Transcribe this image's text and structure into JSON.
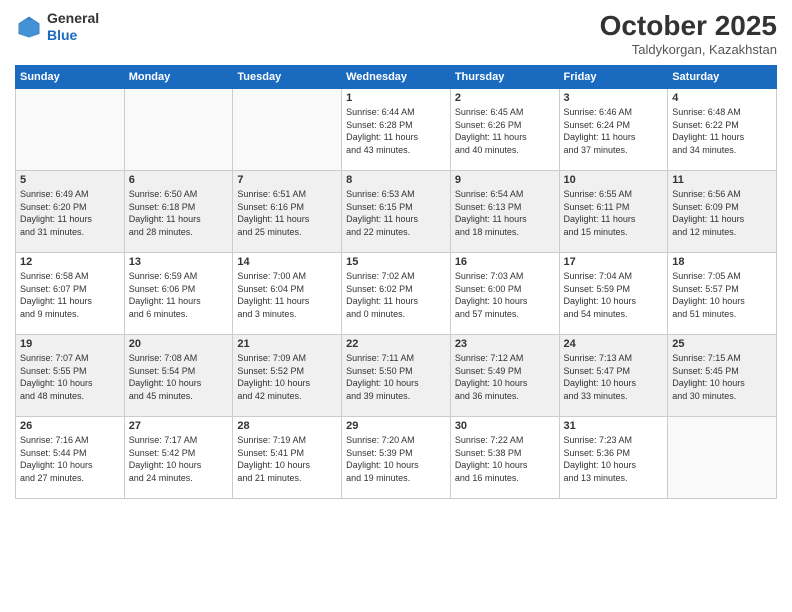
{
  "header": {
    "logo_line1": "General",
    "logo_line2": "Blue",
    "month": "October 2025",
    "location": "Taldykorgan, Kazakhstan"
  },
  "days_of_week": [
    "Sunday",
    "Monday",
    "Tuesday",
    "Wednesday",
    "Thursday",
    "Friday",
    "Saturday"
  ],
  "weeks": [
    [
      {
        "num": "",
        "info": ""
      },
      {
        "num": "",
        "info": ""
      },
      {
        "num": "",
        "info": ""
      },
      {
        "num": "1",
        "info": "Sunrise: 6:44 AM\nSunset: 6:28 PM\nDaylight: 11 hours\nand 43 minutes."
      },
      {
        "num": "2",
        "info": "Sunrise: 6:45 AM\nSunset: 6:26 PM\nDaylight: 11 hours\nand 40 minutes."
      },
      {
        "num": "3",
        "info": "Sunrise: 6:46 AM\nSunset: 6:24 PM\nDaylight: 11 hours\nand 37 minutes."
      },
      {
        "num": "4",
        "info": "Sunrise: 6:48 AM\nSunset: 6:22 PM\nDaylight: 11 hours\nand 34 minutes."
      }
    ],
    [
      {
        "num": "5",
        "info": "Sunrise: 6:49 AM\nSunset: 6:20 PM\nDaylight: 11 hours\nand 31 minutes."
      },
      {
        "num": "6",
        "info": "Sunrise: 6:50 AM\nSunset: 6:18 PM\nDaylight: 11 hours\nand 28 minutes."
      },
      {
        "num": "7",
        "info": "Sunrise: 6:51 AM\nSunset: 6:16 PM\nDaylight: 11 hours\nand 25 minutes."
      },
      {
        "num": "8",
        "info": "Sunrise: 6:53 AM\nSunset: 6:15 PM\nDaylight: 11 hours\nand 22 minutes."
      },
      {
        "num": "9",
        "info": "Sunrise: 6:54 AM\nSunset: 6:13 PM\nDaylight: 11 hours\nand 18 minutes."
      },
      {
        "num": "10",
        "info": "Sunrise: 6:55 AM\nSunset: 6:11 PM\nDaylight: 11 hours\nand 15 minutes."
      },
      {
        "num": "11",
        "info": "Sunrise: 6:56 AM\nSunset: 6:09 PM\nDaylight: 11 hours\nand 12 minutes."
      }
    ],
    [
      {
        "num": "12",
        "info": "Sunrise: 6:58 AM\nSunset: 6:07 PM\nDaylight: 11 hours\nand 9 minutes."
      },
      {
        "num": "13",
        "info": "Sunrise: 6:59 AM\nSunset: 6:06 PM\nDaylight: 11 hours\nand 6 minutes."
      },
      {
        "num": "14",
        "info": "Sunrise: 7:00 AM\nSunset: 6:04 PM\nDaylight: 11 hours\nand 3 minutes."
      },
      {
        "num": "15",
        "info": "Sunrise: 7:02 AM\nSunset: 6:02 PM\nDaylight: 11 hours\nand 0 minutes."
      },
      {
        "num": "16",
        "info": "Sunrise: 7:03 AM\nSunset: 6:00 PM\nDaylight: 10 hours\nand 57 minutes."
      },
      {
        "num": "17",
        "info": "Sunrise: 7:04 AM\nSunset: 5:59 PM\nDaylight: 10 hours\nand 54 minutes."
      },
      {
        "num": "18",
        "info": "Sunrise: 7:05 AM\nSunset: 5:57 PM\nDaylight: 10 hours\nand 51 minutes."
      }
    ],
    [
      {
        "num": "19",
        "info": "Sunrise: 7:07 AM\nSunset: 5:55 PM\nDaylight: 10 hours\nand 48 minutes."
      },
      {
        "num": "20",
        "info": "Sunrise: 7:08 AM\nSunset: 5:54 PM\nDaylight: 10 hours\nand 45 minutes."
      },
      {
        "num": "21",
        "info": "Sunrise: 7:09 AM\nSunset: 5:52 PM\nDaylight: 10 hours\nand 42 minutes."
      },
      {
        "num": "22",
        "info": "Sunrise: 7:11 AM\nSunset: 5:50 PM\nDaylight: 10 hours\nand 39 minutes."
      },
      {
        "num": "23",
        "info": "Sunrise: 7:12 AM\nSunset: 5:49 PM\nDaylight: 10 hours\nand 36 minutes."
      },
      {
        "num": "24",
        "info": "Sunrise: 7:13 AM\nSunset: 5:47 PM\nDaylight: 10 hours\nand 33 minutes."
      },
      {
        "num": "25",
        "info": "Sunrise: 7:15 AM\nSunset: 5:45 PM\nDaylight: 10 hours\nand 30 minutes."
      }
    ],
    [
      {
        "num": "26",
        "info": "Sunrise: 7:16 AM\nSunset: 5:44 PM\nDaylight: 10 hours\nand 27 minutes."
      },
      {
        "num": "27",
        "info": "Sunrise: 7:17 AM\nSunset: 5:42 PM\nDaylight: 10 hours\nand 24 minutes."
      },
      {
        "num": "28",
        "info": "Sunrise: 7:19 AM\nSunset: 5:41 PM\nDaylight: 10 hours\nand 21 minutes."
      },
      {
        "num": "29",
        "info": "Sunrise: 7:20 AM\nSunset: 5:39 PM\nDaylight: 10 hours\nand 19 minutes."
      },
      {
        "num": "30",
        "info": "Sunrise: 7:22 AM\nSunset: 5:38 PM\nDaylight: 10 hours\nand 16 minutes."
      },
      {
        "num": "31",
        "info": "Sunrise: 7:23 AM\nSunset: 5:36 PM\nDaylight: 10 hours\nand 13 minutes."
      },
      {
        "num": "",
        "info": ""
      }
    ]
  ]
}
